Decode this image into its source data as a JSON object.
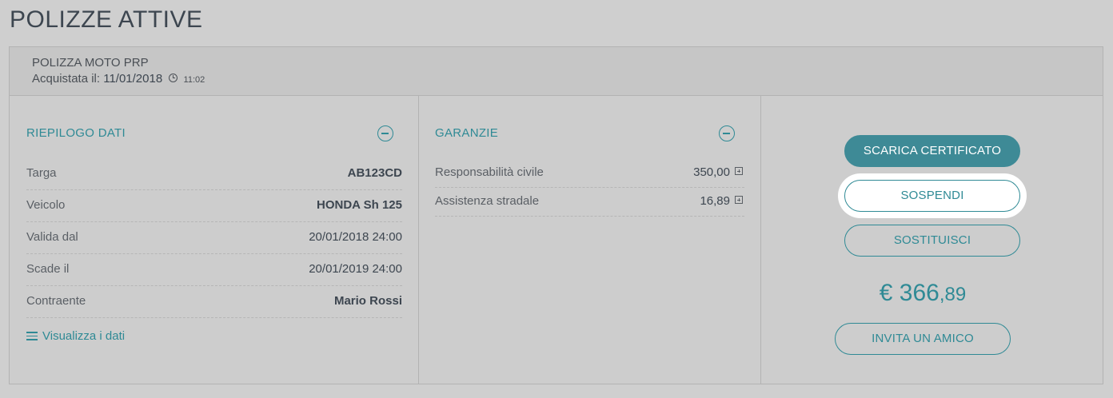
{
  "page": {
    "title": "POLIZZE ATTIVE"
  },
  "policy": {
    "name": "POLIZZA MOTO PRP",
    "purchased_label": "Acquistata il:",
    "purchased_date": "11/01/2018",
    "purchased_time": "11:02"
  },
  "summary": {
    "title": "RIEPILOGO DATI",
    "rows": [
      {
        "label": "Targa",
        "value": "AB123CD"
      },
      {
        "label": "Veicolo",
        "value": "HONDA Sh 125"
      },
      {
        "label": "Valida dal",
        "value": "20/01/2018 24:00"
      },
      {
        "label": "Scade il",
        "value": "20/01/2019 24:00"
      },
      {
        "label": "Contraente",
        "value": "Mario Rossi"
      }
    ],
    "view_link": "Visualizza i dati"
  },
  "guarantees": {
    "title": "GARANZIE",
    "rows": [
      {
        "label": "Responsabilità civile",
        "value": "350,00"
      },
      {
        "label": "Assistenza stradale",
        "value": "16,89"
      }
    ]
  },
  "actions": {
    "download_certificate": "SCARICA CERTIFICATO",
    "suspend": "SOSPENDI",
    "replace": "SOSTITUISCI",
    "invite_friend": "INVITA UN AMICO"
  },
  "price": {
    "currency": "€",
    "integer": "366",
    "cents": ",89"
  },
  "colors": {
    "accent": "#2f8a95",
    "primary_button": "#3e8a96",
    "background": "#cfcfcf"
  }
}
